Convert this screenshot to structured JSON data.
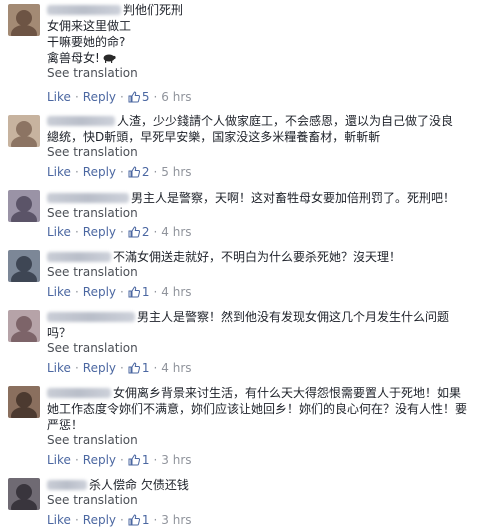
{
  "common": {
    "see_translation": "See translation",
    "like": "Like",
    "reply": "Reply",
    "dot": "·"
  },
  "comments": [
    {
      "lines": [
        "判他们死刑",
        "女佣来这里做工",
        "干嘛要她的命?",
        "禽兽母女!"
      ],
      "likes": "5",
      "time": "6 hrs",
      "avatar_colors": [
        "#a38a74",
        "#6d5444"
      ]
    },
    {
      "lines": [
        "人渣，少少錢請个人做家庭工，不会感恩，還以为自己做了没良",
        "總统，快D斬頭，早死早安樂，国家没这多米糧養畜材，斬斬斬"
      ],
      "likes": "2",
      "time": "5 hrs",
      "avatar_colors": [
        "#c7b39f",
        "#8c7463"
      ]
    },
    {
      "lines": [
        "男主人是警察，天啊！这对畜牲母女要加倍刑罚了。死刑吧！"
      ],
      "likes": "2",
      "time": "4 hrs",
      "avatar_colors": [
        "#9a93a6",
        "#5b5468"
      ]
    },
    {
      "lines": [
        "不滿女佣送走就好，不明白为什么要杀死她？沒天理！"
      ],
      "likes": "1",
      "time": "4 hrs",
      "avatar_colors": [
        "#7c8797",
        "#3e4654"
      ]
    },
    {
      "lines": [
        "男主人是警察！然到他没有发现女佣这几个月发生什么问题",
        "吗？"
      ],
      "likes": "1",
      "time": "4 hrs",
      "avatar_colors": [
        "#b6a3a8",
        "#7d6469"
      ]
    },
    {
      "lines": [
        "女佣离乡背景来讨生活，有什么天大得怨恨需要置人于死地！如果",
        "她工作态度令妳们不满意，妳们应该让她回乡！妳们的良心何在？没有人性！要",
        "严惩！"
      ],
      "likes": "1",
      "time": "3 hrs",
      "avatar_colors": [
        "#8a6f5e",
        "#4c3a30"
      ]
    },
    {
      "lines": [
        "杀人偿命 欠债还钱"
      ],
      "likes": "1",
      "time": "3 hrs",
      "avatar_colors": [
        "#6f6a73",
        "#39353d"
      ]
    }
  ]
}
